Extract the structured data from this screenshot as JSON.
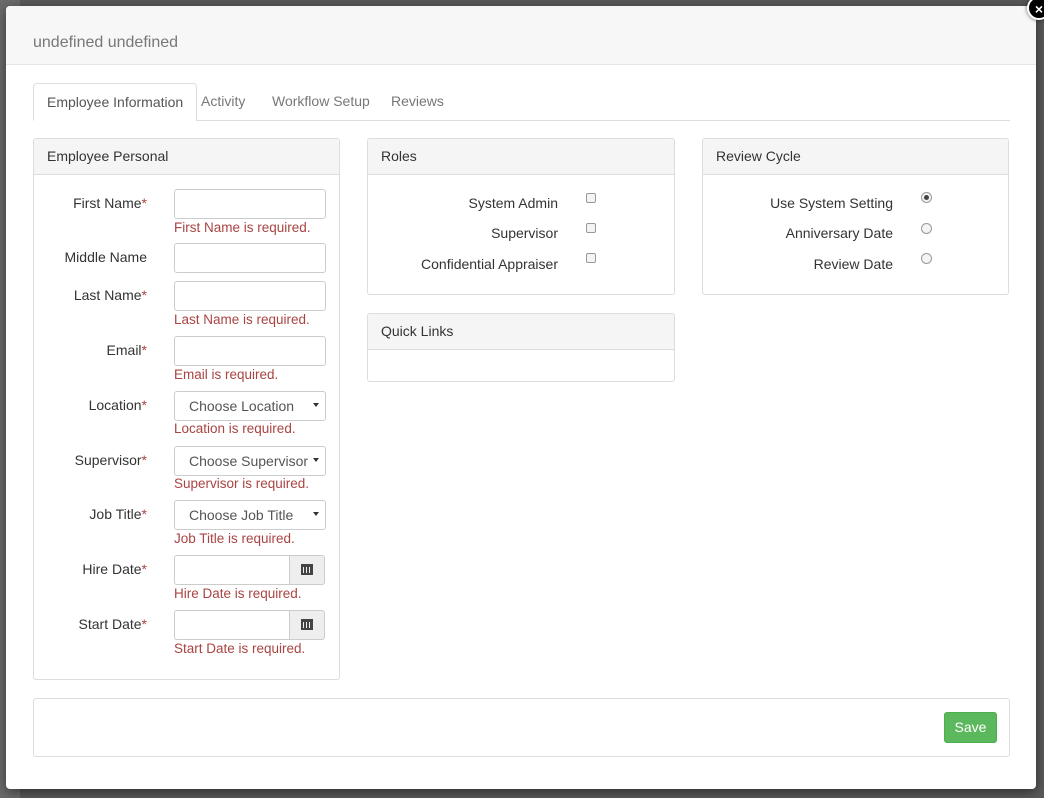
{
  "modal": {
    "title": "undefined undefined",
    "close_glyph": "×"
  },
  "tabs": [
    {
      "label": "Employee Information",
      "active": true
    },
    {
      "label": "Activity",
      "active": false
    },
    {
      "label": "Workflow Setup",
      "active": false
    },
    {
      "label": "Reviews",
      "active": false
    }
  ],
  "employee_personal": {
    "heading": "Employee Personal",
    "required_marker": "*",
    "fields": {
      "first_name": {
        "label": "First Name",
        "value": "",
        "error": "First Name is required."
      },
      "middle_name": {
        "label": "Middle Name",
        "value": ""
      },
      "last_name": {
        "label": "Last Name",
        "value": "",
        "error": "Last Name is required."
      },
      "email": {
        "label": "Email",
        "value": "",
        "error": "Email is required."
      },
      "location": {
        "label": "Location",
        "selected": "Choose Location",
        "error": "Location is required."
      },
      "supervisor": {
        "label": "Supervisor",
        "selected": "Choose Supervisor",
        "error": "Supervisor is required."
      },
      "job_title": {
        "label": "Job Title",
        "selected": "Choose Job Title",
        "error": "Job Title is required."
      },
      "hire_date": {
        "label": "Hire Date",
        "value": "",
        "error": "Hire Date is required.",
        "icon": "calendar-icon"
      },
      "start_date": {
        "label": "Start Date",
        "value": "",
        "error": "Start Date is required.",
        "icon": "calendar-icon"
      }
    }
  },
  "roles": {
    "heading": "Roles",
    "items": [
      {
        "label": "System Admin",
        "checked": false
      },
      {
        "label": "Supervisor",
        "checked": false
      },
      {
        "label": "Confidential Appraiser",
        "checked": false
      }
    ]
  },
  "quick_links": {
    "heading": "Quick Links"
  },
  "review_cycle": {
    "heading": "Review Cycle",
    "options": [
      {
        "label": "Use System Setting",
        "checked": true
      },
      {
        "label": "Anniversary Date",
        "checked": false
      },
      {
        "label": "Review Date",
        "checked": false
      }
    ]
  },
  "footer": {
    "save_label": "Save"
  },
  "colors": {
    "error": "#a94442",
    "save": "#5cb85c",
    "header_bg": "#f7f7f7"
  }
}
